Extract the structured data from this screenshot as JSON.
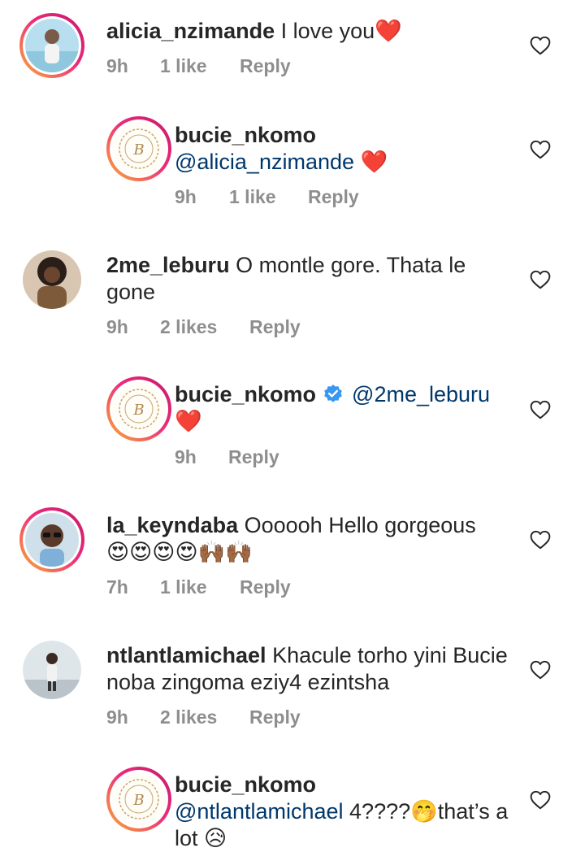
{
  "comments": [
    {
      "username": "alicia_nzimande",
      "text": "I love you",
      "emoji": "❤️",
      "time": "9h",
      "likes": "1 like",
      "reply": "Reply",
      "avatar": "woman-photo-avatar"
    },
    {
      "username": "bucie_nkomo",
      "mention": "@alicia_nzimande",
      "emoji": "❤️",
      "time": "9h",
      "likes": "1 like",
      "reply": "Reply",
      "avatar": "brand-logo-avatar"
    },
    {
      "username": "2me_leburu",
      "text": "O montle gore. Thata le gone",
      "time": "9h",
      "likes": "2 likes",
      "reply": "Reply",
      "avatar": "woman-photo-avatar"
    },
    {
      "username": "bucie_nkomo",
      "verified": true,
      "mention": "@2me_leburu",
      "emoji": "❤️",
      "time": "9h",
      "reply": "Reply",
      "avatar": "brand-logo-avatar"
    },
    {
      "username": "la_keyndaba",
      "text": "Oooooh Hello gorgeous",
      "emoji": "😍😍😍😍🙌🏾🙌🏾",
      "time": "7h",
      "likes": "1 like",
      "reply": "Reply",
      "avatar": "man-glasses-photo-avatar"
    },
    {
      "username": "ntlantlamichael",
      "text": "Khacule torho yini Bucie noba zingoma eziy4 ezintsha",
      "time": "9h",
      "likes": "2 likes",
      "reply": "Reply",
      "avatar": "man-photo-avatar"
    },
    {
      "username": "bucie_nkomo",
      "mention": "@ntlantlamichael",
      "text_a": "4????",
      "emoji_a": "🤭",
      "text_b": "that’s a lot",
      "emoji_b": "😥",
      "avatar": "brand-logo-avatar"
    }
  ],
  "colors": {
    "text": "#262626",
    "meta": "#8e8e8e",
    "mention": "#00376b",
    "verified": "#3897f0",
    "heart": "#e0142a"
  },
  "icons": [
    "heart-outline-icon",
    "verified-badge-icon"
  ]
}
